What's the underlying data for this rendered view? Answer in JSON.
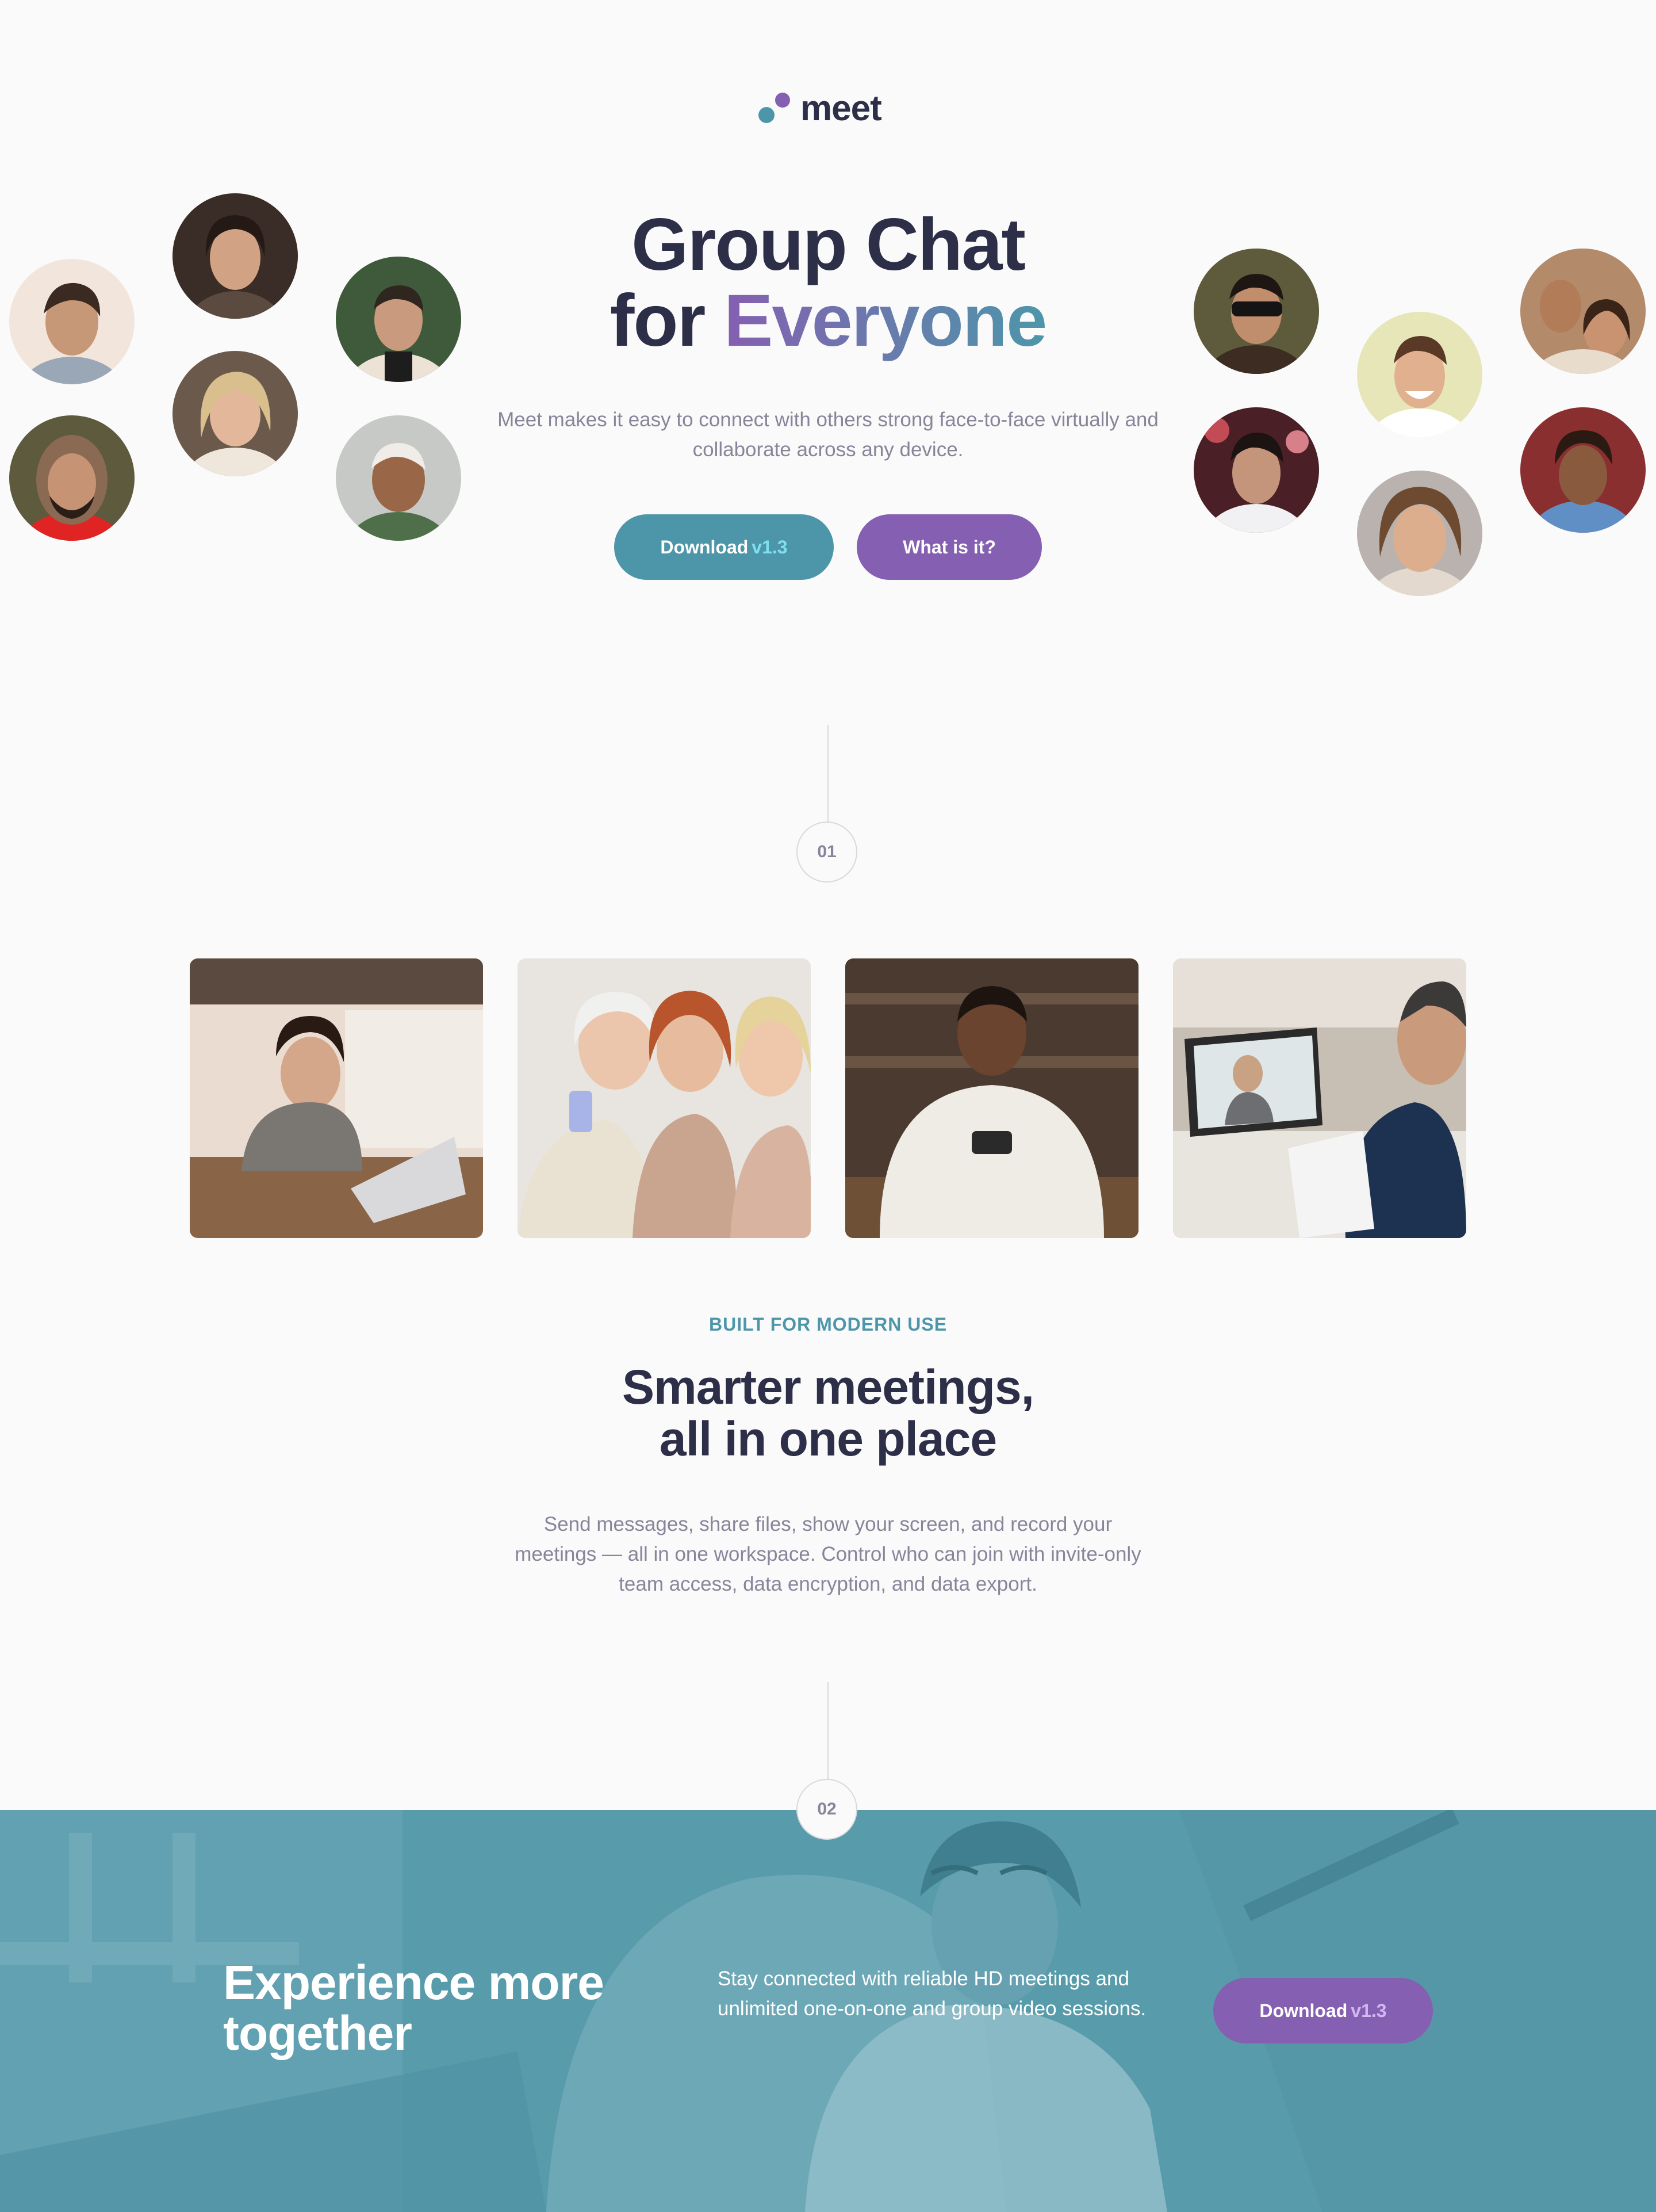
{
  "brand": {
    "name": "meet",
    "colors": {
      "dark": "#2d2e47",
      "teal": "#4d96a9",
      "purple": "#855fb1",
      "muted": "#87859a",
      "background": "#fafafa"
    }
  },
  "hero": {
    "title_line1": "Group Chat",
    "title_line2_prefix": "for ",
    "title_line2_highlight": "Everyone",
    "description": "Meet makes it easy to connect with others strong face-to-face virtually and collaborate across any device.",
    "download_label": "Download",
    "download_version": "v1.3",
    "what_label": "What is it?"
  },
  "steps": [
    "01",
    "02"
  ],
  "features": {
    "eyebrow": "BUILT FOR MODERN USE",
    "title_line1": "Smarter meetings,",
    "title_line2": "all in one place",
    "description": "Send messages, share files, show your screen, and record your meetings — all in one workspace. Control who can join with invite-only team access, data encryption, and data export."
  },
  "cta": {
    "title_line1": "Experience more",
    "title_line2": "together",
    "description": "Stay connected with reliable HD meetings and unlimited one-on-one and group video sessions.",
    "download_label": "Download",
    "download_version": "v1.3"
  }
}
